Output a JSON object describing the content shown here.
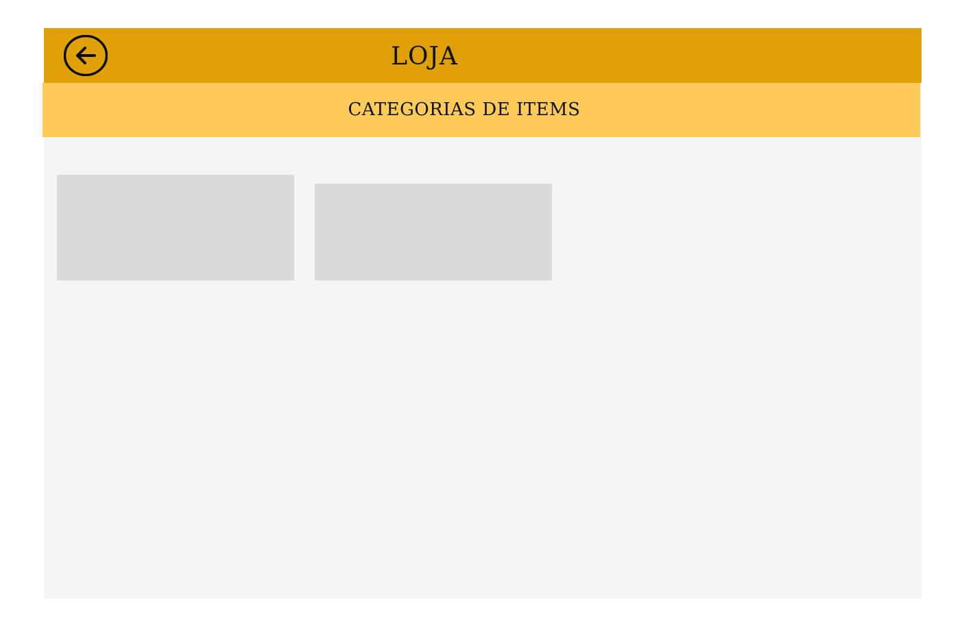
{
  "header": {
    "title": "LOJA",
    "back_icon": "arrow-left-circle-icon",
    "background_color": "#e0a008"
  },
  "subheader": {
    "title": "CATEGORIAS DE ITEMS",
    "background_color": "#fecb5a"
  },
  "content": {
    "background_color": "#f4f4f4",
    "card_color": "#d9d9d9",
    "category_cards": [
      {
        "label": ""
      },
      {
        "label": ""
      }
    ]
  }
}
